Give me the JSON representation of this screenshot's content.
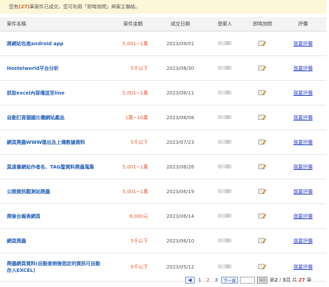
{
  "notice": {
    "prefix": "您有",
    "count": "(27)",
    "suffix": "筆案件已成交，您可利用「即時詢問」與案主聯絡。"
  },
  "table": {
    "headers": {
      "name": "案件名稱",
      "amount": "案件金額",
      "date": "成交日期",
      "publisher": "發案人",
      "inquiry": "即時詢問",
      "rating": "評價"
    },
    "rows": [
      {
        "name": "將網站包進android app",
        "amount": "5,001~1萬",
        "date": "2023/09/01",
        "rate_label": "我要評價"
      },
      {
        "name": "Hostelworld平台分析",
        "amount": "5千以下",
        "date": "2023/08/30",
        "rate_label": "我要評價"
      },
      {
        "name": "抓取excel內容傳送至line",
        "amount": "5,001~1萬",
        "date": "2023/08/11",
        "rate_label": "我要評價"
      },
      {
        "name": "自動訂貨德國比價網站產品",
        "amount": "1萬~10萬",
        "date": "2023/08/08",
        "rate_label": "我要評價"
      },
      {
        "name": "網頁爬蟲WWW匯出及上傳數據資料",
        "amount": "5千以下",
        "date": "2023/07/23",
        "rate_label": "我要評價"
      },
      {
        "name": "莫遠書網站作者名、TAG暨資料爬蟲蒐集",
        "amount": "5,001~1萬",
        "date": "2023/06/26",
        "rate_label": "我要評價"
      },
      {
        "name": "公開資訊觀測站爬蟲",
        "amount": "5,001~1萬",
        "date": "2023/06/19",
        "rate_label": "我要評價"
      },
      {
        "name": "爬後台報表網頁",
        "amount": "6,000元",
        "date": "2023/06/14",
        "rate_label": "我要評價"
      },
      {
        "name": "網頁爬蟲",
        "amount": "5千以下",
        "date": "2023/06/10",
        "rate_label": "我要評價"
      },
      {
        "name": "爬蟲網頁資料(自動查詢後固定的資訊可自動存入EXCEL)",
        "amount": "5千以下",
        "date": "2023/05/12",
        "rate_label": "我要評價"
      }
    ]
  },
  "pager": {
    "prev": "◀",
    "pages": [
      "1",
      "2",
      "3"
    ],
    "current": "2",
    "next": "下一頁",
    "go": "GO",
    "info_prefix": "第",
    "info_page": "2",
    "info_sep": " / ",
    "info_total_pages": "3",
    "info_mid": "頁 共",
    "info_total_items": "27",
    "info_suffix": "筆"
  },
  "colors": {
    "accent": "#2560b6",
    "amount": "#ef5a2e",
    "link": "#2d44c8",
    "notice_bg": "#fdf6d8"
  },
  "icons": {
    "inquiry": "pencil-note-icon",
    "publisher": "blurred-avatar"
  }
}
